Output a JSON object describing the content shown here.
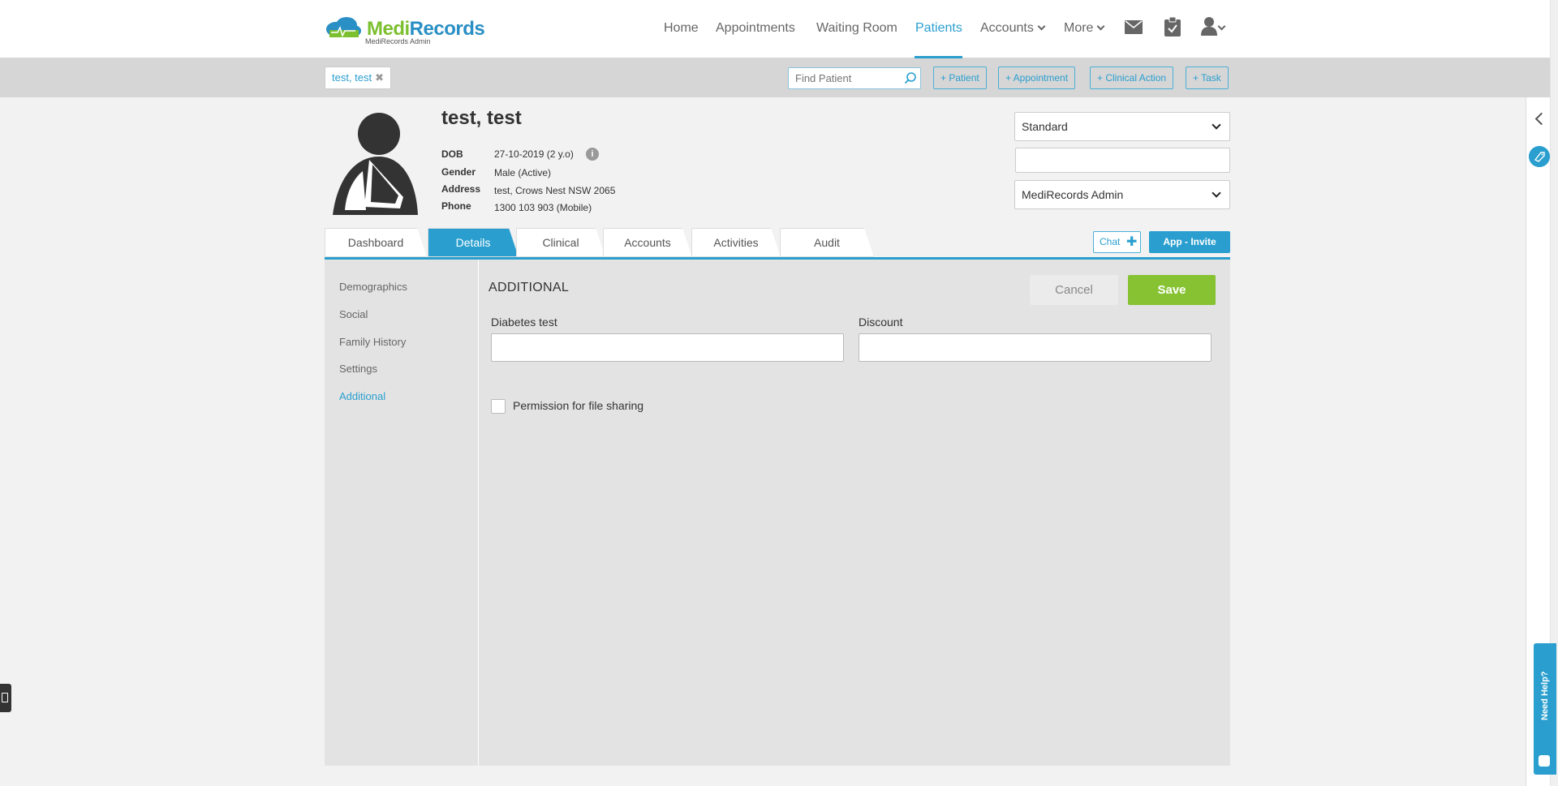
{
  "brand": {
    "name_part1": "Medi",
    "name_part2": "Records",
    "subtitle": "MediRecords Admin"
  },
  "nav": {
    "home": "Home",
    "appointments": "Appointments",
    "waiting_room": "Waiting Room",
    "patients": "Patients",
    "accounts": "Accounts",
    "more": "More",
    "active": "Patients"
  },
  "subbar": {
    "patient_tab": "test, test",
    "find_placeholder": "Find Patient",
    "btn_patient": "+ Patient",
    "btn_appointment": "+ Appointment",
    "btn_clinical_action": "+ Clinical Action",
    "btn_task": "+ Task"
  },
  "patient": {
    "name": "test, test",
    "dob_label": "DOB",
    "dob": "27-10-2019 (2 y.o)",
    "gender_label": "Gender",
    "gender": "Male (Active)",
    "address_label": "Address",
    "address": "test, Crows Nest NSW 2065",
    "phone_label": "Phone",
    "phone": "1300 103 903 (Mobile)"
  },
  "selectors": {
    "type": "Standard",
    "practice": "MediRecords Admin"
  },
  "tabs": {
    "dashboard": "Dashboard",
    "details": "Details",
    "clinical": "Clinical",
    "accounts": "Accounts",
    "activities": "Activities",
    "audit": "Audit",
    "active": "Details"
  },
  "actions": {
    "chat": "Chat",
    "app_invite": "App - Invite"
  },
  "sidebar": {
    "items": [
      {
        "label": "Demographics"
      },
      {
        "label": "Social"
      },
      {
        "label": "Family History"
      },
      {
        "label": "Settings"
      },
      {
        "label": "Additional"
      }
    ],
    "active": "Additional"
  },
  "form": {
    "title": "ADDITIONAL",
    "cancel": "Cancel",
    "save": "Save",
    "field1_label": "Diabetes test",
    "field1_value": "",
    "field2_label": "Discount",
    "field2_value": "",
    "checkbox_label": "Permission for file sharing",
    "checkbox_checked": false
  },
  "help": {
    "label": "Need Help?"
  },
  "colors": {
    "accent": "#2a9fcf",
    "save": "#86c232",
    "brand_green": "#7cbf2f",
    "brand_blue": "#2a8fc4"
  }
}
